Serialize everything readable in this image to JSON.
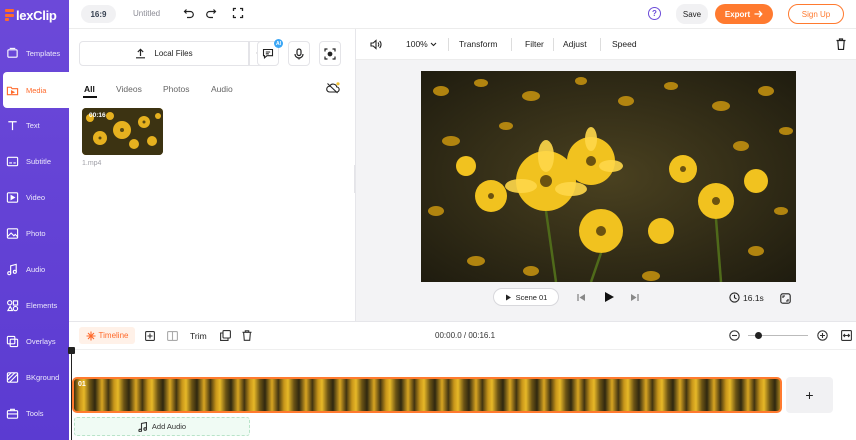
{
  "app": {
    "logo": "lexClip"
  },
  "sidebar": {
    "items": [
      {
        "label": "Templates",
        "icon": "templates-icon"
      },
      {
        "label": "Media",
        "icon": "media-icon",
        "active": true
      },
      {
        "label": "Text",
        "icon": "text-icon"
      },
      {
        "label": "Subtitle",
        "icon": "subtitle-icon"
      },
      {
        "label": "Video",
        "icon": "video-icon"
      },
      {
        "label": "Photo",
        "icon": "photo-icon"
      },
      {
        "label": "Audio",
        "icon": "audio-icon"
      },
      {
        "label": "Elements",
        "icon": "elements-icon"
      },
      {
        "label": "Overlays",
        "icon": "overlays-icon"
      },
      {
        "label": "BKground",
        "icon": "background-icon"
      },
      {
        "label": "Tools",
        "icon": "tools-icon"
      }
    ]
  },
  "topbar": {
    "ratio": "16:9",
    "title": "Untitled",
    "save": "Save",
    "export": "Export",
    "signup": "Sign Up",
    "help": "?"
  },
  "media": {
    "local_files": "Local Files",
    "ai_badge": "AI",
    "tabs": [
      "All",
      "Videos",
      "Photos",
      "Audio"
    ],
    "item": {
      "duration": "00:16",
      "name": "1.mp4"
    }
  },
  "editor": {
    "zoom": "100%",
    "tools": [
      "Transform",
      "Filter",
      "Adjust",
      "Speed"
    ],
    "scene": "Scene 01",
    "duration": "16.1s"
  },
  "timeline": {
    "label": "Timeline",
    "trim": "Trim",
    "time": "00:00.0 / 00:16.1",
    "clip_label": "01",
    "add_audio": "Add Audio",
    "add_scene": "+"
  },
  "colors": {
    "accent": "#ff7a2f",
    "sidebar": "#5b3bd1",
    "brand": "#6b4bd8"
  }
}
